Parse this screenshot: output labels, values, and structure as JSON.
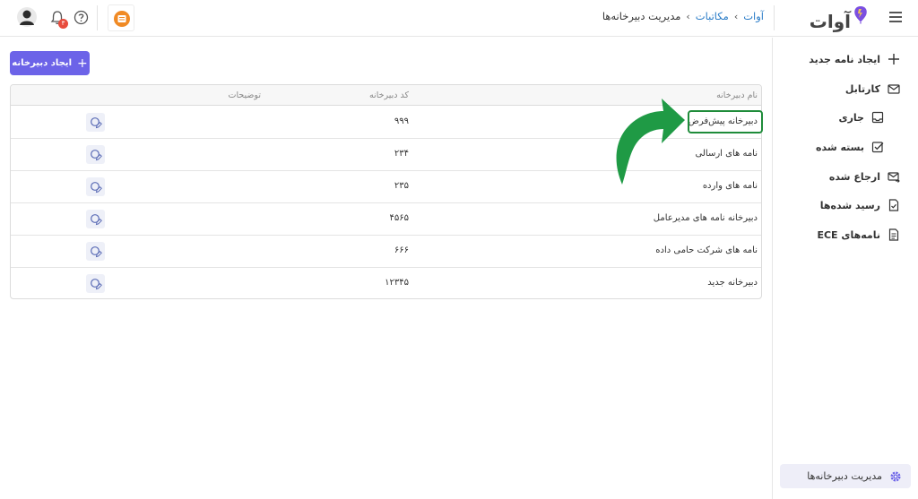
{
  "header": {
    "logo_text": "آوات",
    "breadcrumb": [
      "آوات",
      "مکاتبات",
      "مدیریت دبیرخانه‌ها"
    ],
    "notification_count": "۳",
    "icons": [
      "hamburger-icon",
      "logo-balloon-icon",
      "avatar-icon",
      "bell-icon",
      "help-icon",
      "app-icon"
    ]
  },
  "sidebar": {
    "items": [
      {
        "label": "ایجاد نامه جدید",
        "icon": "plus-icon"
      },
      {
        "label": "کارتابل",
        "icon": "envelope-icon"
      },
      {
        "label": "جاری",
        "icon": "inbox-tray-icon"
      },
      {
        "label": "بسته شده",
        "icon": "checkbox-icon"
      },
      {
        "label": "ارجاع شده",
        "icon": "forward-mail-icon"
      },
      {
        "label": "رسید شده‌ها",
        "icon": "receipt-check-icon"
      },
      {
        "label": "نامه‌های ECE",
        "icon": "document-icon"
      }
    ],
    "bottom": {
      "label": "مدیریت دبیرخانه‌ها",
      "icon": "gear-icon"
    }
  },
  "toolbar": {
    "create_label": "ایجاد دبیرخانه"
  },
  "table": {
    "columns": [
      "نام دبیرخانه",
      "کد دبیرخانه",
      "توضیحات"
    ],
    "rows": [
      {
        "name": "دبیرخانه پیش‌فرض",
        "code": "۹۹۹"
      },
      {
        "name": "نامه های ارسالی",
        "code": "۲۳۴"
      },
      {
        "name": "نامه های وارده",
        "code": "۲۳۵"
      },
      {
        "name": "دبیرخانه نامه های مدیرعامل",
        "code": "۴۵۶۵"
      },
      {
        "name": "نامه های شرکت حامی داده",
        "code": "۶۶۶"
      },
      {
        "name": "دبیرخانه جدید",
        "code": "۱۲۳۴۵"
      }
    ]
  },
  "colors": {
    "accent": "#6c63e8",
    "highlight": "#1f8c3a",
    "link": "#2a7cc7",
    "badge": "#e84b3c"
  }
}
